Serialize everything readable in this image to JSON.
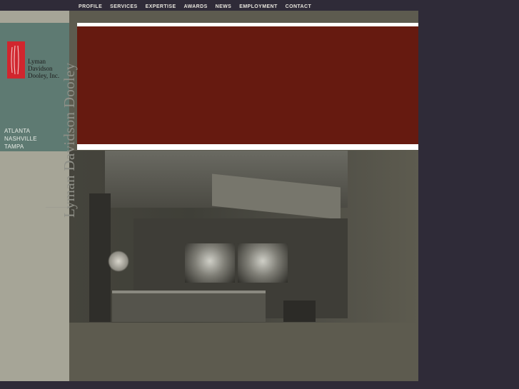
{
  "nav": {
    "items": [
      "PROFILE",
      "SERVICES",
      "EXPERTISE",
      "AWARDS",
      "NEWS",
      "EMPLOYMENT",
      "CONTACT"
    ]
  },
  "logo": {
    "line1": "Lyman",
    "line2": "Davidson",
    "line3": "Dooley, Inc."
  },
  "offices": [
    "ATLANTA",
    "NASHVILLE",
    "TAMPA"
  ],
  "vertical_name": "Lyman Davidson Dooley",
  "colors": {
    "background": "#2f2b38",
    "banner": "#661a10",
    "logo_red": "#d1262e",
    "teal_panel": "#5e7a72"
  }
}
